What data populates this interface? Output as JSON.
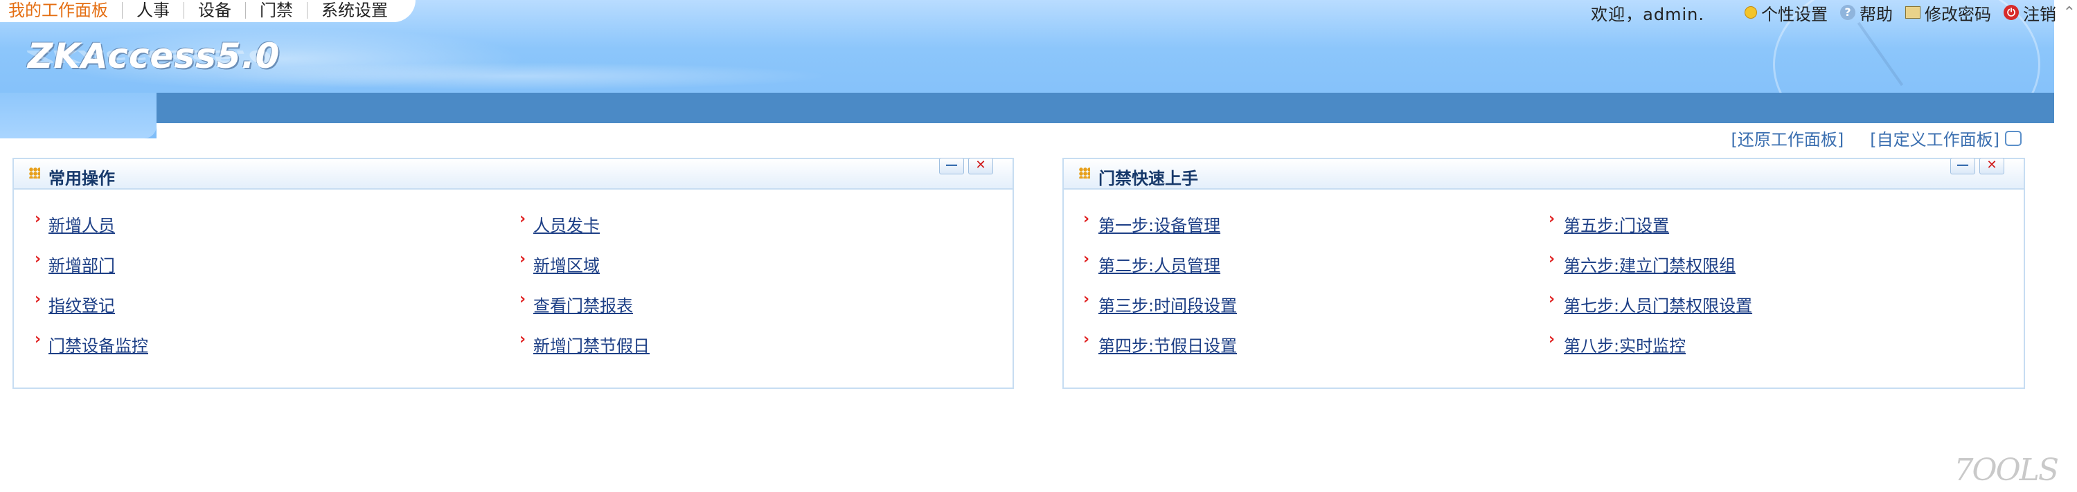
{
  "nav": {
    "items": [
      "我的工作面板",
      "人事",
      "设备",
      "门禁",
      "系统设置"
    ]
  },
  "logo": "ZKAccess5.0",
  "user": {
    "welcome": "欢迎，admin.",
    "personalize": "个性设置",
    "help": "帮助",
    "change_password": "修改密码",
    "logout": "注销"
  },
  "workspace": {
    "restore": "[还原工作面板]",
    "customize": "[自定义工作面板]"
  },
  "panels": {
    "common": {
      "title": "常用操作",
      "links": [
        "新增人员",
        "新增部门",
        "指纹登记",
        "门禁设备监控",
        "人员发卡",
        "新增区域",
        "查看门禁报表",
        "新增门禁节假日"
      ]
    },
    "quickstart": {
      "title": "门禁快速上手",
      "links": [
        "第一步:设备管理",
        "第二步:人员管理",
        "第三步:时间段设置",
        "第四步:节假日设置",
        "第五步:门设置",
        "第六步:建立门禁权限组",
        "第七步:人员门禁权限设置",
        "第八步:实时监控"
      ]
    }
  },
  "watermark": "7OOLS",
  "colors": {
    "accent_nav": "#e46e12",
    "banner_bar": "#4b8ac6",
    "link": "#1d3f86",
    "arrow": "#e02020"
  }
}
